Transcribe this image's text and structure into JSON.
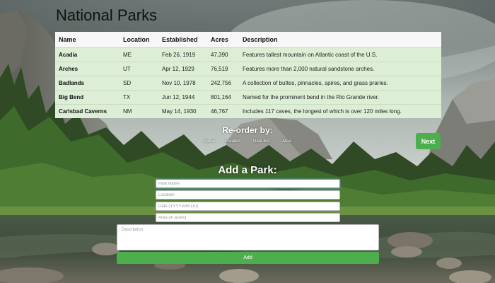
{
  "page": {
    "title": "National Parks"
  },
  "table": {
    "headers": [
      "Name",
      "Location",
      "Established",
      "Acres",
      "Description"
    ],
    "rows": [
      {
        "name": "Acadia",
        "location": "ME",
        "established": "Feb 26, 1919",
        "acres": "47,390",
        "description": "Features tallest mountain on Atlantic coast of the U.S."
      },
      {
        "name": "Arches",
        "location": "UT",
        "established": "Apr 12, 1929",
        "acres": "76,519",
        "description": "Features more than 2,000 natural sandstone arches."
      },
      {
        "name": "Badlands",
        "location": "SD",
        "established": "Nov 10, 1978",
        "acres": "242,756",
        "description": "A collection of buttes, pinnacles, spires, and grass praries."
      },
      {
        "name": "Big Bend",
        "location": "TX",
        "established": "Jun 12, 1944",
        "acres": "801,164",
        "description": "Named for the prominent bend in the Rio Grande river."
      },
      {
        "name": "Carlsbad Caverns",
        "location": "NM",
        "established": "May 14, 1930",
        "acres": "46,767",
        "description": "Includes 117 caves, the longest of which is over 120 miles long."
      }
    ]
  },
  "reorder": {
    "title": "Re-order by:",
    "options": [
      "Name",
      "Location",
      "Date Est.",
      "Area"
    ]
  },
  "next_label": "Next",
  "form": {
    "title": "Add a Park:",
    "placeholders": {
      "name": "Park Name",
      "location": "Location",
      "date": "Date (YYYY-MM-DD)",
      "area": "Area (in acres)",
      "description": "Description"
    },
    "add_label": "Add"
  },
  "colors": {
    "table_row_bg": "#dcefd6",
    "header_bg": "#f7f7f7",
    "button_green": "#4cae4c"
  }
}
